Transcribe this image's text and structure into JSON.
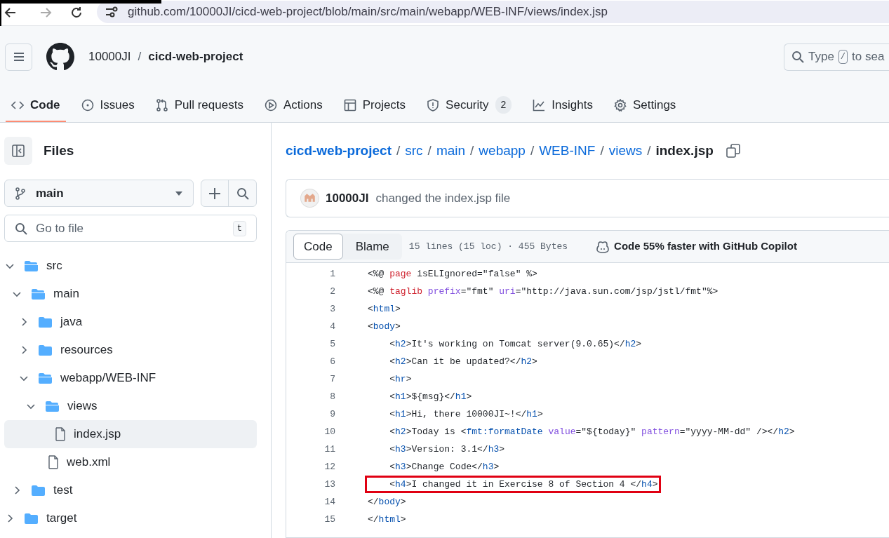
{
  "browser": {
    "url": "github.com/10000JI/cicd-web-project/blob/main/src/main/webapp/WEB-INF/views/index.jsp"
  },
  "header": {
    "owner": "10000JI",
    "separator": "/",
    "repo": "cicd-web-project",
    "search": {
      "placeholder_before": "Type",
      "key": "/",
      "placeholder_after": "to sea"
    }
  },
  "tabs": [
    {
      "label": "Code",
      "selected": true
    },
    {
      "label": "Issues",
      "selected": false
    },
    {
      "label": "Pull requests",
      "selected": false
    },
    {
      "label": "Actions",
      "selected": false
    },
    {
      "label": "Projects",
      "selected": false
    },
    {
      "label": "Security",
      "selected": false,
      "count": "2"
    },
    {
      "label": "Insights",
      "selected": false
    },
    {
      "label": "Settings",
      "selected": false
    }
  ],
  "sidebar": {
    "title": "Files",
    "branch": "main",
    "file_search": {
      "placeholder": "Go to file",
      "shortcut": "t"
    },
    "tree": [
      {
        "name": "src",
        "kind": "folder",
        "expanded": true,
        "selected": false,
        "children": [
          {
            "name": "main",
            "kind": "folder",
            "expanded": true,
            "selected": false,
            "children": [
              {
                "name": "java",
                "kind": "folder",
                "expanded": false,
                "selected": false
              },
              {
                "name": "resources",
                "kind": "folder",
                "expanded": false,
                "selected": false
              },
              {
                "name": "webapp/WEB-INF",
                "kind": "folder",
                "expanded": true,
                "selected": false,
                "children": [
                  {
                    "name": "views",
                    "kind": "folder",
                    "expanded": true,
                    "selected": false,
                    "children": [
                      {
                        "name": "index.jsp",
                        "kind": "file",
                        "selected": true
                      }
                    ]
                  },
                  {
                    "name": "web.xml",
                    "kind": "file",
                    "selected": false
                  }
                ]
              }
            ]
          },
          {
            "name": "test",
            "kind": "folder",
            "expanded": false,
            "selected": false
          }
        ]
      },
      {
        "name": "target",
        "kind": "folder",
        "expanded": false,
        "selected": false
      }
    ]
  },
  "breadcrumb": {
    "parts": [
      "cicd-web-project",
      "src",
      "main",
      "webapp",
      "WEB-INF",
      "views"
    ],
    "separator": "/",
    "current": "index.jsp"
  },
  "commit": {
    "author": "10000JI",
    "message": "changed the index.jsp file"
  },
  "file_toolbar": {
    "views": [
      {
        "label": "Code",
        "selected": true
      },
      {
        "label": "Blame",
        "selected": false
      }
    ],
    "info": "15 lines (15 loc) · 455 Bytes",
    "copilot": "Code 55% faster with GitHub Copilot"
  },
  "code_lines": [
    {
      "number": "1",
      "highlighted": false,
      "tokens": [
        {
          "kind": "text",
          "text": "<%@ "
        },
        {
          "kind": "keyword",
          "text": "page"
        },
        {
          "kind": "text",
          "text": " isELIgnored=\"false\" %>"
        }
      ]
    },
    {
      "number": "2",
      "highlighted": false,
      "tokens": [
        {
          "kind": "text",
          "text": "<%@ "
        },
        {
          "kind": "keyword",
          "text": "taglib"
        },
        {
          "kind": "attr",
          "text": " prefix"
        },
        {
          "kind": "text",
          "text": "=\"fmt\" "
        },
        {
          "kind": "attr",
          "text": "uri"
        },
        {
          "kind": "text",
          "text": "=\"http://java.sun.com/jsp/jstl/fmt\"%>"
        }
      ]
    },
    {
      "number": "3",
      "highlighted": false,
      "tokens": [
        {
          "kind": "text",
          "text": "<"
        },
        {
          "kind": "tag",
          "text": "html"
        },
        {
          "kind": "text",
          "text": ">"
        }
      ]
    },
    {
      "number": "4",
      "highlighted": false,
      "tokens": [
        {
          "kind": "text",
          "text": "<"
        },
        {
          "kind": "tag",
          "text": "body"
        },
        {
          "kind": "text",
          "text": ">"
        }
      ]
    },
    {
      "number": "5",
      "highlighted": false,
      "tokens": [
        {
          "kind": "text",
          "text": "    <"
        },
        {
          "kind": "tag",
          "text": "h2"
        },
        {
          "kind": "text",
          "text": ">It's working on Tomcat server(9.0.65)</"
        },
        {
          "kind": "tag",
          "text": "h2"
        },
        {
          "kind": "text",
          "text": ">"
        }
      ]
    },
    {
      "number": "6",
      "highlighted": false,
      "tokens": [
        {
          "kind": "text",
          "text": "    <"
        },
        {
          "kind": "tag",
          "text": "h2"
        },
        {
          "kind": "text",
          "text": ">Can it be updated?</"
        },
        {
          "kind": "tag",
          "text": "h2"
        },
        {
          "kind": "text",
          "text": ">"
        }
      ]
    },
    {
      "number": "7",
      "highlighted": false,
      "tokens": [
        {
          "kind": "text",
          "text": "    <"
        },
        {
          "kind": "tag",
          "text": "hr"
        },
        {
          "kind": "text",
          "text": ">"
        }
      ]
    },
    {
      "number": "8",
      "highlighted": false,
      "tokens": [
        {
          "kind": "text",
          "text": "    <"
        },
        {
          "kind": "tag",
          "text": "h1"
        },
        {
          "kind": "text",
          "text": ">${msg}</"
        },
        {
          "kind": "tag",
          "text": "h1"
        },
        {
          "kind": "text",
          "text": ">"
        }
      ]
    },
    {
      "number": "9",
      "highlighted": false,
      "tokens": [
        {
          "kind": "text",
          "text": "    <"
        },
        {
          "kind": "tag",
          "text": "h1"
        },
        {
          "kind": "text",
          "text": ">Hi, there 10000JI~!</"
        },
        {
          "kind": "tag",
          "text": "h1"
        },
        {
          "kind": "text",
          "text": ">"
        }
      ]
    },
    {
      "number": "10",
      "highlighted": false,
      "tokens": [
        {
          "kind": "text",
          "text": "    <"
        },
        {
          "kind": "tag",
          "text": "h2"
        },
        {
          "kind": "text",
          "text": ">Today is <"
        },
        {
          "kind": "tag",
          "text": "fmt:formatDate"
        },
        {
          "kind": "attr",
          "text": " value"
        },
        {
          "kind": "text",
          "text": "=\"${today}\" "
        },
        {
          "kind": "attr",
          "text": "pattern"
        },
        {
          "kind": "text",
          "text": "=\"yyyy-MM-dd\" /></"
        },
        {
          "kind": "tag",
          "text": "h2"
        },
        {
          "kind": "text",
          "text": ">"
        }
      ]
    },
    {
      "number": "11",
      "highlighted": false,
      "tokens": [
        {
          "kind": "text",
          "text": "    <"
        },
        {
          "kind": "tag",
          "text": "h3"
        },
        {
          "kind": "text",
          "text": ">Version: 3.1</"
        },
        {
          "kind": "tag",
          "text": "h3"
        },
        {
          "kind": "text",
          "text": ">"
        }
      ]
    },
    {
      "number": "12",
      "highlighted": false,
      "tokens": [
        {
          "kind": "text",
          "text": "    <"
        },
        {
          "kind": "tag",
          "text": "h3"
        },
        {
          "kind": "text",
          "text": ">Change Code</"
        },
        {
          "kind": "tag",
          "text": "h3"
        },
        {
          "kind": "text",
          "text": ">"
        }
      ]
    },
    {
      "number": "13",
      "highlighted": true,
      "tokens": [
        {
          "kind": "text",
          "text": "    <"
        },
        {
          "kind": "tag",
          "text": "h4"
        },
        {
          "kind": "text",
          "text": ">I changed it in Exercise 8 of Section 4 </"
        },
        {
          "kind": "tag",
          "text": "h4"
        },
        {
          "kind": "text",
          "text": ">"
        }
      ]
    },
    {
      "number": "14",
      "highlighted": false,
      "tokens": [
        {
          "kind": "text",
          "text": "</"
        },
        {
          "kind": "tag",
          "text": "body"
        },
        {
          "kind": "text",
          "text": ">"
        }
      ]
    },
    {
      "number": "15",
      "highlighted": false,
      "tokens": [
        {
          "kind": "text",
          "text": "</"
        },
        {
          "kind": "tag",
          "text": "html"
        },
        {
          "kind": "text",
          "text": ">"
        }
      ]
    }
  ]
}
